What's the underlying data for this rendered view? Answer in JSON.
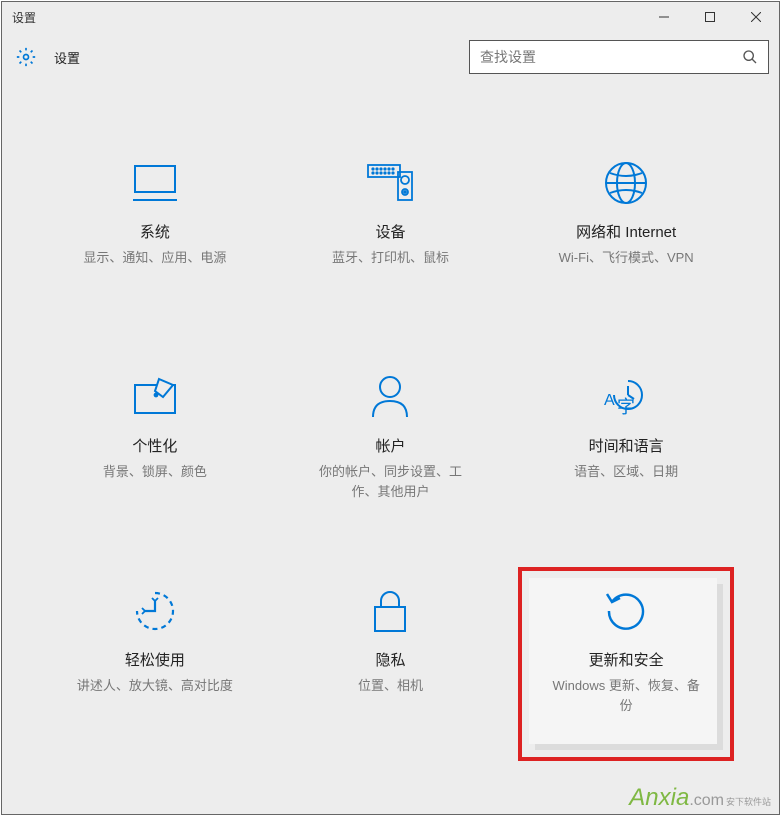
{
  "titlebar": {
    "title": "设置"
  },
  "header": {
    "title": "设置"
  },
  "search": {
    "placeholder": "查找设置"
  },
  "tiles": [
    {
      "title": "系统",
      "desc": "显示、通知、应用、电源"
    },
    {
      "title": "设备",
      "desc": "蓝牙、打印机、鼠标"
    },
    {
      "title": "网络和 Internet",
      "desc": "Wi-Fi、飞行模式、VPN"
    },
    {
      "title": "个性化",
      "desc": "背景、锁屏、颜色"
    },
    {
      "title": "帐户",
      "desc": "你的帐户、同步设置、工作、其他用户"
    },
    {
      "title": "时间和语言",
      "desc": "语音、区域、日期"
    },
    {
      "title": "轻松使用",
      "desc": "讲述人、放大镜、高对比度"
    },
    {
      "title": "隐私",
      "desc": "位置、相机"
    },
    {
      "title": "更新和安全",
      "desc": "Windows 更新、恢复、备份"
    }
  ],
  "watermark": {
    "brand": "Anxia",
    "suffix": ".com",
    "sub": "安下软件站"
  }
}
